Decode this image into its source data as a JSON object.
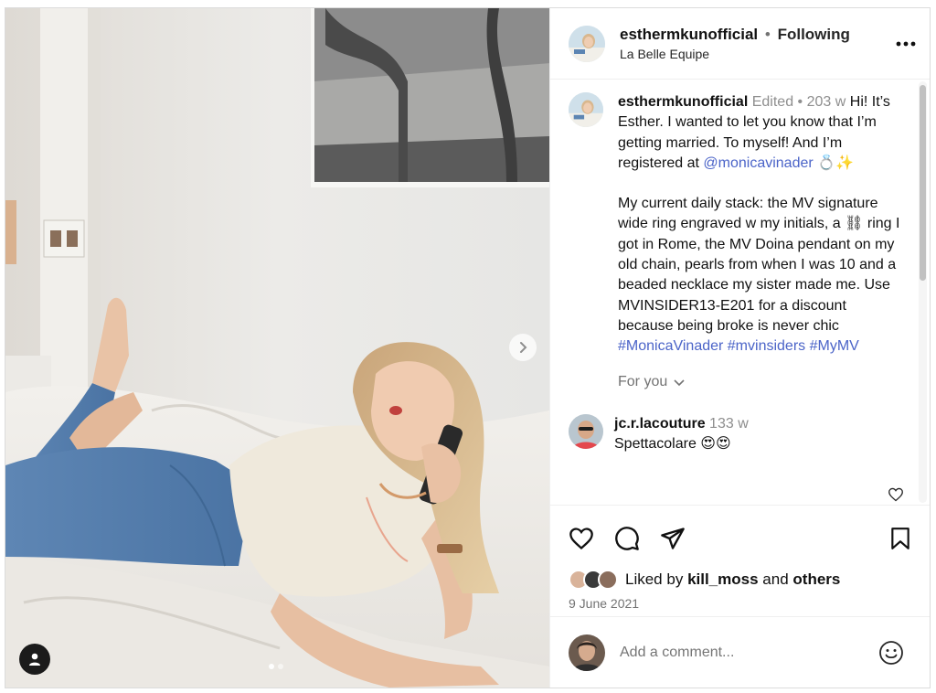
{
  "post": {
    "username": "esthermkunofficial",
    "separator": "•",
    "follow_state": "Following",
    "location": "La Belle Equipe"
  },
  "caption": {
    "username": "esthermkunofficial",
    "edited": "Edited",
    "bullet": "•",
    "age": "203 w",
    "line1": "Hi! It’s Esther. I wanted to let you know that I’m getting married. To myself! And I’m registered at",
    "mention": "@monicavinader",
    "mention_suffix": "💍✨",
    "line2": "My current daily stack: the MV signature wide ring engraved w my initials, a ⛓ ring I got in Rome, the MV Doina pendant on my old chain, pearls from when I was 10 and a beaded necklace my sister made me. Use MVINSIDER13-E201 for a discount because being broke is never chic",
    "hashtags": "#MonicaVinader #mvinsiders #MyMV",
    "for_you": "For you"
  },
  "comment": {
    "username": "jc.r.lacouture",
    "age": "133 w",
    "text": "Spettacolare 😍😍"
  },
  "likes": {
    "prefix": "Liked by",
    "user": "kill_moss",
    "connector": "and",
    "others": "others"
  },
  "date": "9 June 2021",
  "add_comment": {
    "placeholder": "Add a comment..."
  },
  "icons": {
    "like": "heart-icon",
    "comment": "comment-bubble-icon",
    "share": "paper-plane-icon",
    "save": "bookmark-icon",
    "more": "more-dots-icon",
    "next": "chevron-right-icon",
    "tag": "person-icon",
    "emoji": "smiley-icon",
    "for_you_chevron": "chevron-down-icon"
  },
  "colors": {
    "link": "#4b64c8",
    "muted": "#737373",
    "border": "#dbdbdb"
  }
}
